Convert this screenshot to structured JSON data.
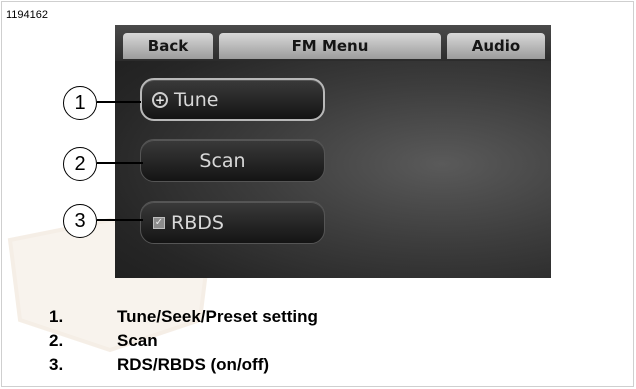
{
  "figure_id": "1194162",
  "screen": {
    "tabs": {
      "back": "Back",
      "title": "FM Menu",
      "audio": "Audio"
    },
    "buttons": {
      "tune": {
        "label": "Tune",
        "icon": "tune-icon"
      },
      "scan": {
        "label": "Scan"
      },
      "rbds": {
        "label": "RBDS",
        "icon": "check-icon",
        "checked": true
      }
    }
  },
  "callouts": [
    "1",
    "2",
    "3"
  ],
  "legend": [
    {
      "num": "1.",
      "text": "Tune/Seek/Preset setting"
    },
    {
      "num": "2.",
      "text": "Scan"
    },
    {
      "num": "3.",
      "text": "RDS/RBDS (on/off)"
    }
  ]
}
